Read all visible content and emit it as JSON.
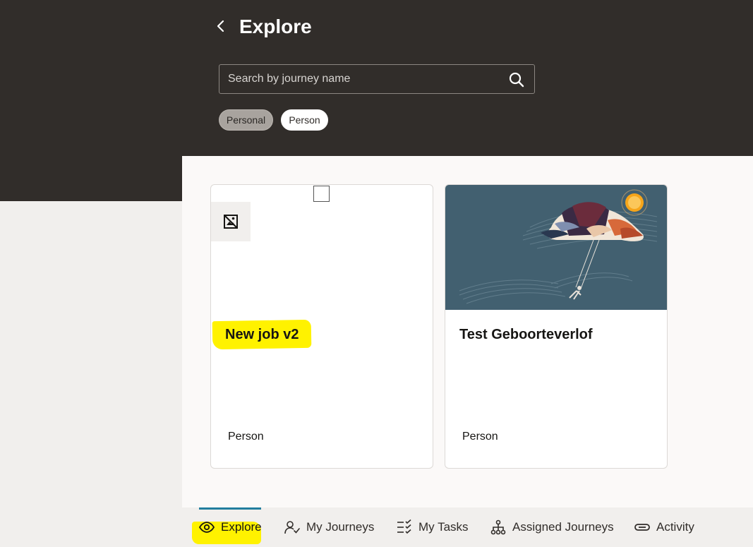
{
  "header": {
    "title": "Explore",
    "back_icon": "chevron-left-icon"
  },
  "search": {
    "placeholder": "Search by journey name",
    "value": "",
    "icon": "search-icon"
  },
  "filters": [
    {
      "label": "Personal",
      "selected": true
    },
    {
      "label": "Person",
      "selected": false
    }
  ],
  "cards": [
    {
      "title": "New job v2",
      "category": "Person",
      "image": "broken-image-icon",
      "highlighted": true
    },
    {
      "title": "Test Geboorteverlof",
      "category": "Person",
      "image": "illustration-swing-cloud"
    }
  ],
  "bottom_nav": {
    "items": [
      {
        "label": "Explore",
        "icon": "eye-icon",
        "active": true
      },
      {
        "label": "My Journeys",
        "icon": "person-check-icon"
      },
      {
        "label": "My Tasks",
        "icon": "checklist-icon"
      },
      {
        "label": "Assigned Journeys",
        "icon": "hierarchy-icon"
      },
      {
        "label": "Activity",
        "icon": "link-icon"
      }
    ]
  },
  "colors": {
    "header_bg": "#312d2a",
    "content_bg": "#fbf9f8",
    "active_tab": "#227e9e",
    "highlight": "#fff200"
  }
}
